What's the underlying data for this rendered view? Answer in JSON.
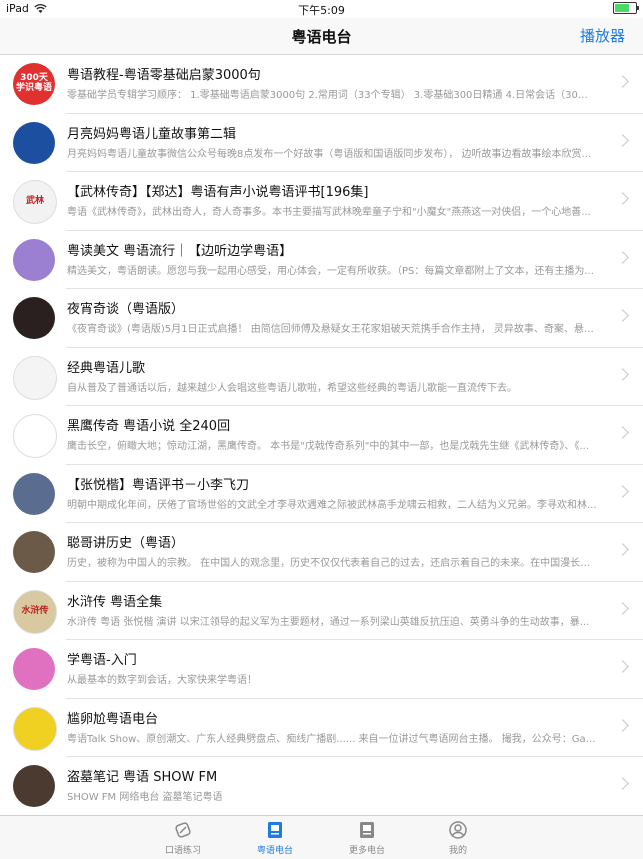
{
  "status": {
    "device": "iPad",
    "time": "下午5:09"
  },
  "nav": {
    "title": "粤语电台",
    "player_button": "播放器"
  },
  "items": [
    {
      "title": "粤语教程-粤语零基础启蒙3000句",
      "desc": "零基础学员专辑学习顺序： 1.零基础粤语启蒙3000句 2.常用词（33个专辑） 3.零基础300日精通 4.日常会话（30个专...",
      "avatar_text": "300天 学识粤语",
      "color": "#e03030"
    },
    {
      "title": "月亮妈妈粤语儿童故事第二辑",
      "desc": "月亮妈妈粤语儿童故事微信公众号每晚8点发布一个好故事（粤语版和国语版同步发布）， 边听故事边看故事绘本欣赏...",
      "avatar_text": "",
      "color": "#1d4fa0"
    },
    {
      "title": "【武林传奇】【郑达】粤语有声小说粤语评书[196集]",
      "desc": "粤语《武林传奇》，武林出奇人，奇人奇事多。本书主要描写武林晚辈童子宁和\"小魔女\"燕燕这一对侠侣，一个心地善...",
      "avatar_text": "武林",
      "color": "#f2f2f2"
    },
    {
      "title": "粤读美文 粤语流行｜【边听边学粤语】",
      "desc": "精选美文，粤语朗读。愿您与我一起用心感受，用心体会，一定有所收获。（PS：每篇文章都附上了文本，还有主播为...",
      "avatar_text": "",
      "color": "#9b7fd0"
    },
    {
      "title": "夜宵奇谈（粤语版）",
      "desc": "《夜宵奇谈》(粤语版)5月1日正式启播！ 由简信回师傅及悬疑女王花家姐破天荒携手合作主持， 灵异故事、奇案、悬疑...",
      "avatar_text": "",
      "color": "#2a2020"
    },
    {
      "title": "经典粤语儿歌",
      "desc": "自从普及了普通话以后，越来越少人会唱这些粤语儿歌啦，希望这些经典的粤语儿歌能一直流传下去。",
      "avatar_text": "",
      "color": "#f4f4f4"
    },
    {
      "title": "黑鹰传奇 粤语小说 全240回",
      "desc": "鹰击长空，俯瞰大地；惊动江湖，黑鹰传奇。 本书是\"戊戟传奇系列\"中的其中一部，也是戊戟先生继《武林传奇》、《...",
      "avatar_text": "",
      "color": "#ffffff"
    },
    {
      "title": "【张悦楷】粤语评书－小李飞刀",
      "desc": "明朝中期成化年间，厌倦了官场世俗的文武全才李寻欢遇难之际被武林高手龙啸云相救，二人结为义兄弟。李寻欢和林...",
      "avatar_text": "",
      "color": "#5a6d90"
    },
    {
      "title": "聪哥讲历史（粤语）",
      "desc": "历史，被称为中国人的宗教。 在中国人的观念里，历史不仅仅代表着自己的过去，还启示着自己的未来。在中国漫长的...",
      "avatar_text": "",
      "color": "#6b5a48"
    },
    {
      "title": "水浒传 粤语全集",
      "desc": "水浒传 粤语 张悦楷 演讲 以宋江领导的起义军为主要题材，通过一系列梁山英雄反抗压迫、英勇斗争的生动故事，暴...",
      "avatar_text": "水浒传",
      "color": "#d9c9a0"
    },
    {
      "title": "学粤语-入门",
      "desc": "从最基本的数字到会话，大家快来学粤语！",
      "avatar_text": "",
      "color": "#e070c0"
    },
    {
      "title": "尴卵尬粤语电台",
      "desc": "粤语Talk Show、原创潮文、广东人经典劈盘点、痴线广播剧...... 来自一位讲过气粤语网台主播。 撮我，公众号：Gaa...",
      "avatar_text": "",
      "color": "#f0d020"
    },
    {
      "title": "盗墓笔记 粤语 SHOW FM",
      "desc": "SHOW FM 网络电台 盗墓笔记粤语",
      "avatar_text": "",
      "color": "#4a3a30"
    }
  ],
  "tabs": [
    {
      "label": "口语练习",
      "icon": "pen-icon",
      "active": false
    },
    {
      "label": "粤语电台",
      "icon": "radio-book-icon",
      "active": true
    },
    {
      "label": "更多电台",
      "icon": "book-icon",
      "active": false
    },
    {
      "label": "我的",
      "icon": "person-icon",
      "active": false
    }
  ],
  "colors": {
    "accent": "#1e7ce0",
    "battery": "#4cd964"
  }
}
